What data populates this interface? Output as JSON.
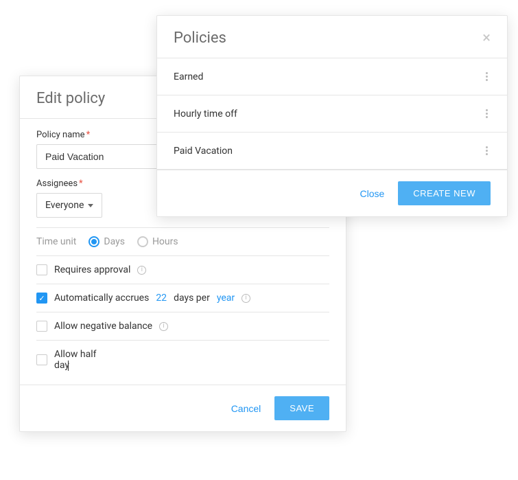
{
  "editPolicy": {
    "title": "Edit policy",
    "policyNameLabel": "Policy name",
    "policyNameValue": "Paid Vacation",
    "assigneesLabel": "Assignees",
    "assigneesValue": "Everyone",
    "timeUnitLabel": "Time unit",
    "timeUnitOptions": {
      "days": "Days",
      "hours": "Hours"
    },
    "timeUnitSelected": "days",
    "options": {
      "requiresApproval": {
        "label": "Requires approval",
        "checked": false
      },
      "autoAccrues": {
        "label_prefix": "Automatically accrues",
        "value": "22",
        "label_mid": "days per",
        "period": "year",
        "checked": true
      },
      "negativeBalance": {
        "label": "Allow negative balance",
        "checked": false
      },
      "halfDay": {
        "label": "Allow half day",
        "checked": false
      }
    },
    "footer": {
      "cancel": "Cancel",
      "save": "SAVE"
    }
  },
  "policies": {
    "title": "Policies",
    "items": [
      {
        "name": "Earned"
      },
      {
        "name": "Hourly time off"
      },
      {
        "name": "Paid Vacation"
      }
    ],
    "footer": {
      "close": "Close",
      "createNew": "CREATE NEW"
    }
  }
}
